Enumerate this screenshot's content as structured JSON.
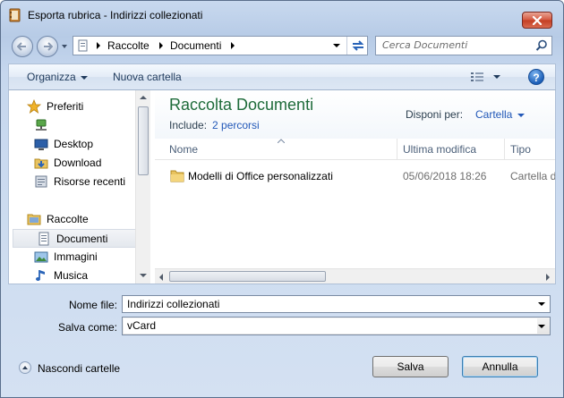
{
  "window": {
    "title": "Esporta rubrica - Indirizzi collezionati"
  },
  "address": {
    "segments": [
      "Raccolte",
      "Documenti"
    ]
  },
  "search": {
    "placeholder": "Cerca Documenti"
  },
  "toolbar": {
    "organize_label": "Organizza",
    "new_folder_label": "Nuova cartella"
  },
  "nav_pane": {
    "items": [
      {
        "label": "Preferiti",
        "icon": "star-icon",
        "top": true
      },
      {
        "label": "",
        "icon": "network-icon",
        "top": false
      },
      {
        "label": "Desktop",
        "icon": "desktop-icon",
        "top": false
      },
      {
        "label": "Download",
        "icon": "download-icon",
        "top": false
      },
      {
        "label": "Risorse recenti",
        "icon": "recent-places-icon",
        "top": false
      },
      {
        "label": "Raccolte",
        "icon": "libraries-icon",
        "top": true
      },
      {
        "label": "Documenti",
        "icon": "documents-icon",
        "top": false,
        "selected": true
      },
      {
        "label": "Immagini",
        "icon": "pictures-icon",
        "top": false
      },
      {
        "label": "Musica",
        "icon": "music-icon",
        "top": false
      }
    ]
  },
  "library": {
    "title": "Raccolta Documenti",
    "include_label": "Include:",
    "include_link": "2 percorsi",
    "arrange_label": "Disponi per:",
    "arrange_value": "Cartella"
  },
  "columns": {
    "name": "Nome",
    "modified": "Ultima modifica",
    "type": "Tipo"
  },
  "files": [
    {
      "name": "Modelli di Office personalizzati",
      "modified": "05/06/2018 18:26",
      "type": "Cartella d"
    }
  ],
  "form": {
    "filename_label": "Nome file:",
    "filename_value": "Indirizzi collezionati",
    "savetype_label": "Salva come:",
    "savetype_value": "vCard"
  },
  "footer": {
    "hide_folders_label": "Nascondi cartelle",
    "save_label": "Salva",
    "cancel_label": "Annulla"
  },
  "colors": {
    "library_title": "#1e6b3a",
    "link": "#2258b8",
    "close_button": "#c33d22"
  }
}
